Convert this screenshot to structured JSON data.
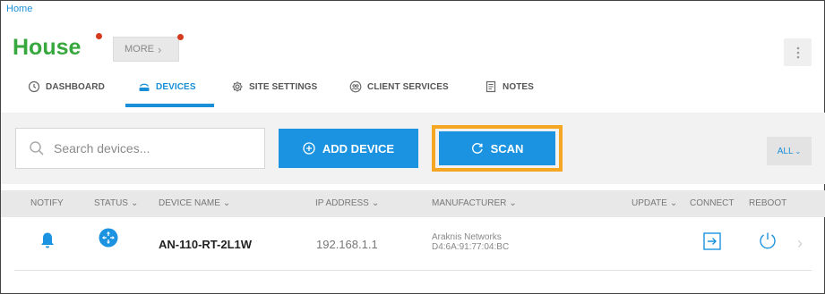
{
  "breadcrumb": "Home",
  "site": {
    "title": "House",
    "more_label": "MORE"
  },
  "tabs": [
    {
      "label": "DASHBOARD",
      "icon": "clock-icon",
      "active": false
    },
    {
      "label": "DEVICES",
      "icon": "router-icon",
      "active": true
    },
    {
      "label": "SITE SETTINGS",
      "icon": "gear-icon",
      "active": false
    },
    {
      "label": "CLIENT SERVICES",
      "icon": "users-icon",
      "active": false
    },
    {
      "label": "NOTES",
      "icon": "notes-icon",
      "active": false
    }
  ],
  "toolbar": {
    "search_placeholder": "Search devices...",
    "add_device_label": "ADD DEVICE",
    "scan_label": "SCAN",
    "filter_label": "ALL"
  },
  "table": {
    "columns": [
      "NOTIFY",
      "STATUS",
      "DEVICE NAME",
      "IP ADDRESS",
      "MANUFACTURER",
      "UPDATE",
      "CONNECT",
      "REBOOT"
    ],
    "rows": [
      {
        "device_name": "AN-110-RT-2L1W",
        "ip_address": "192.168.1.1",
        "manufacturer": "Araknis Networks",
        "mac": "D4:6A:91:77:04:BC"
      }
    ]
  },
  "colors": {
    "accent_blue": "#1b93e0",
    "site_green": "#36a83d",
    "highlight_orange": "#f5a623",
    "notify_dot_red": "#d63a1e"
  }
}
